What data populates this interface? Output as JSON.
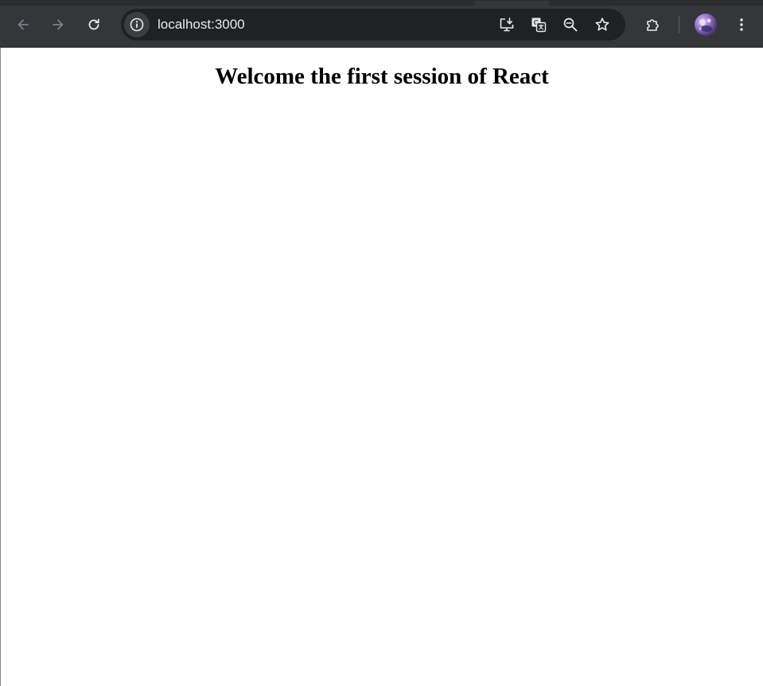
{
  "browser": {
    "url": "localhost:3000",
    "colors": {
      "toolbar": "#35363a",
      "omnibox": "#202124",
      "icon": "#e8eaed",
      "icon_disabled": "#7d8085"
    },
    "icons": {
      "back": "arrow-left-icon",
      "forward": "arrow-right-icon",
      "reload": "reload-icon",
      "site_info": "info-icon",
      "install": "install-app-icon",
      "translate": "translate-icon",
      "zoom": "zoom-out-icon",
      "bookmark": "star-icon",
      "extensions": "puzzle-icon",
      "menu": "kebab-menu-icon"
    }
  },
  "page": {
    "heading": "Welcome the first session of React"
  }
}
